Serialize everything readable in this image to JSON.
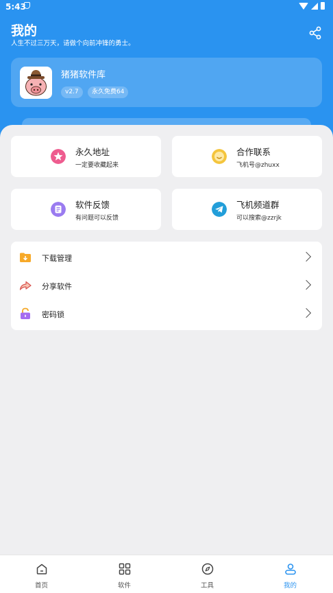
{
  "status_bar": {
    "time": "5:43"
  },
  "header": {
    "title": "我的",
    "subtitle": "人生不过三万天，请做个向前冲锋的勇士。"
  },
  "profile": {
    "app_name": "猪猪软件库",
    "version_tag": "v2.7",
    "plan_tag": "永久免费64"
  },
  "cards": [
    {
      "title": "永久地址",
      "subtitle": "一定要收藏起来",
      "icon": "star-icon",
      "color": "#ee5c8f"
    },
    {
      "title": "合作联系",
      "subtitle": "飞机号@zhuxx",
      "icon": "smile-icon",
      "color": "#f4c53d"
    },
    {
      "title": "软件反馈",
      "subtitle": "有问题可以反馈",
      "icon": "feedback-icon",
      "color": "#9a7bf0"
    },
    {
      "title": "飞机频道群",
      "subtitle": "可以搜索@zzrjk",
      "icon": "telegram-icon",
      "color": "#229ed9"
    }
  ],
  "menu": [
    {
      "label": "下载管理",
      "icon": "download-folder-icon"
    },
    {
      "label": "分享软件",
      "icon": "share-arrow-icon"
    },
    {
      "label": "密码锁",
      "icon": "lock-icon"
    }
  ],
  "tabbar": {
    "items": [
      {
        "label": "首页",
        "icon": "home-icon"
      },
      {
        "label": "软件",
        "icon": "grid-icon"
      },
      {
        "label": "工具",
        "icon": "compass-icon"
      },
      {
        "label": "我的",
        "icon": "user-icon"
      }
    ],
    "active_color": "#2a93f0"
  },
  "colors": {
    "header_bg": "#2a93f0",
    "page_bg": "#efeff1"
  }
}
